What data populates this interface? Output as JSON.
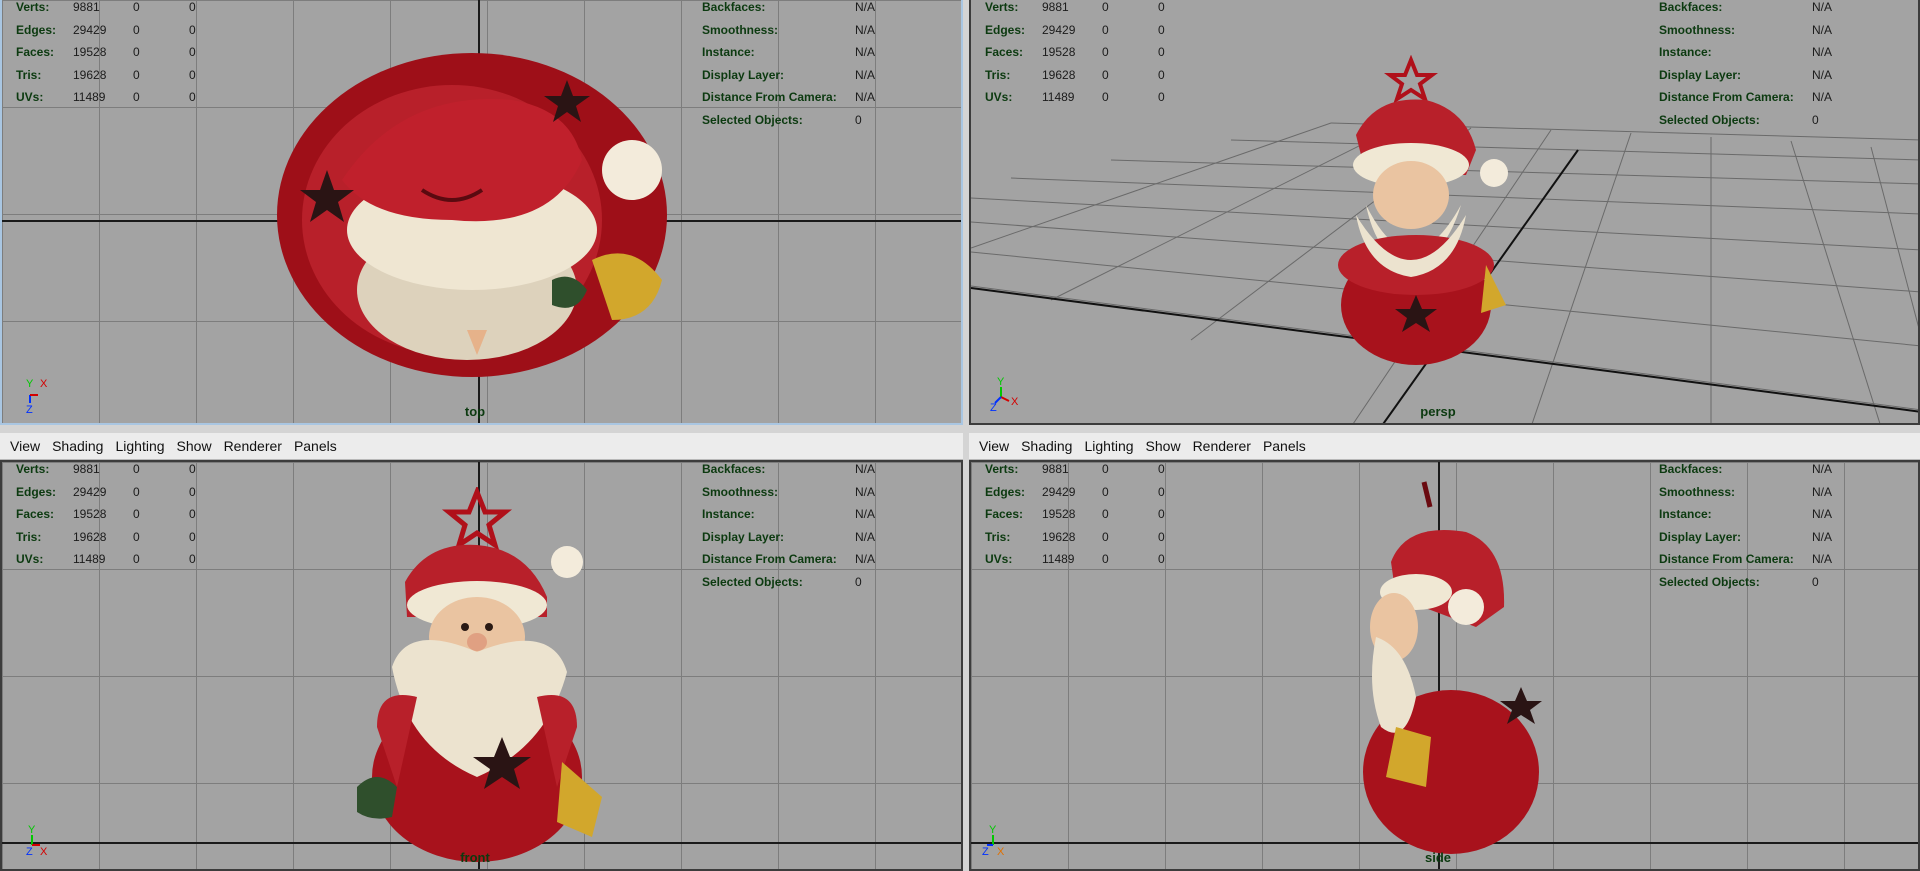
{
  "menubar": [
    "View",
    "Shading",
    "Lighting",
    "Show",
    "Renderer",
    "Panels"
  ],
  "hud_stats": {
    "rows": [
      {
        "label": "Verts:",
        "v1": "9881",
        "v2": "0",
        "v3": "0"
      },
      {
        "label": "Edges:",
        "v1": "29429",
        "v2": "0",
        "v3": "0"
      },
      {
        "label": "Faces:",
        "v1": "19528",
        "v2": "0",
        "v3": "0"
      },
      {
        "label": "Tris:",
        "v1": "19628",
        "v2": "0",
        "v3": "0"
      },
      {
        "label": "UVs:",
        "v1": "11489",
        "v2": "0",
        "v3": "0"
      }
    ]
  },
  "hud_info": {
    "rows": [
      {
        "label": "Backfaces:",
        "value": "N/A"
      },
      {
        "label": "Smoothness:",
        "value": "N/A"
      },
      {
        "label": "Instance:",
        "value": "N/A"
      },
      {
        "label": "Display Layer:",
        "value": "N/A"
      },
      {
        "label": "Distance From Camera:",
        "value": "N/A"
      },
      {
        "label": "Selected Objects:",
        "value": "0"
      }
    ]
  },
  "viewports": {
    "top": {
      "camera": "top"
    },
    "persp": {
      "camera": "persp"
    },
    "front": {
      "camera": "front"
    },
    "side": {
      "camera": "side"
    }
  },
  "gizmo": {
    "top": [
      "Y",
      "X",
      "Z"
    ],
    "persp": [
      "Y",
      "Z",
      "X"
    ],
    "front": [
      "Y",
      "Z",
      "X"
    ],
    "side": [
      "Y",
      "Z",
      "X"
    ]
  },
  "colors": {
    "viewport_bg": "#a3a3a3",
    "hud_label": "#0c3a10",
    "axis_x": "#d40000",
    "axis_y": "#00c800",
    "axis_z": "#0030ff",
    "active_border": "#a9c6e2",
    "santa_red": "#a8121c",
    "santa_white": "#ece3cf"
  }
}
